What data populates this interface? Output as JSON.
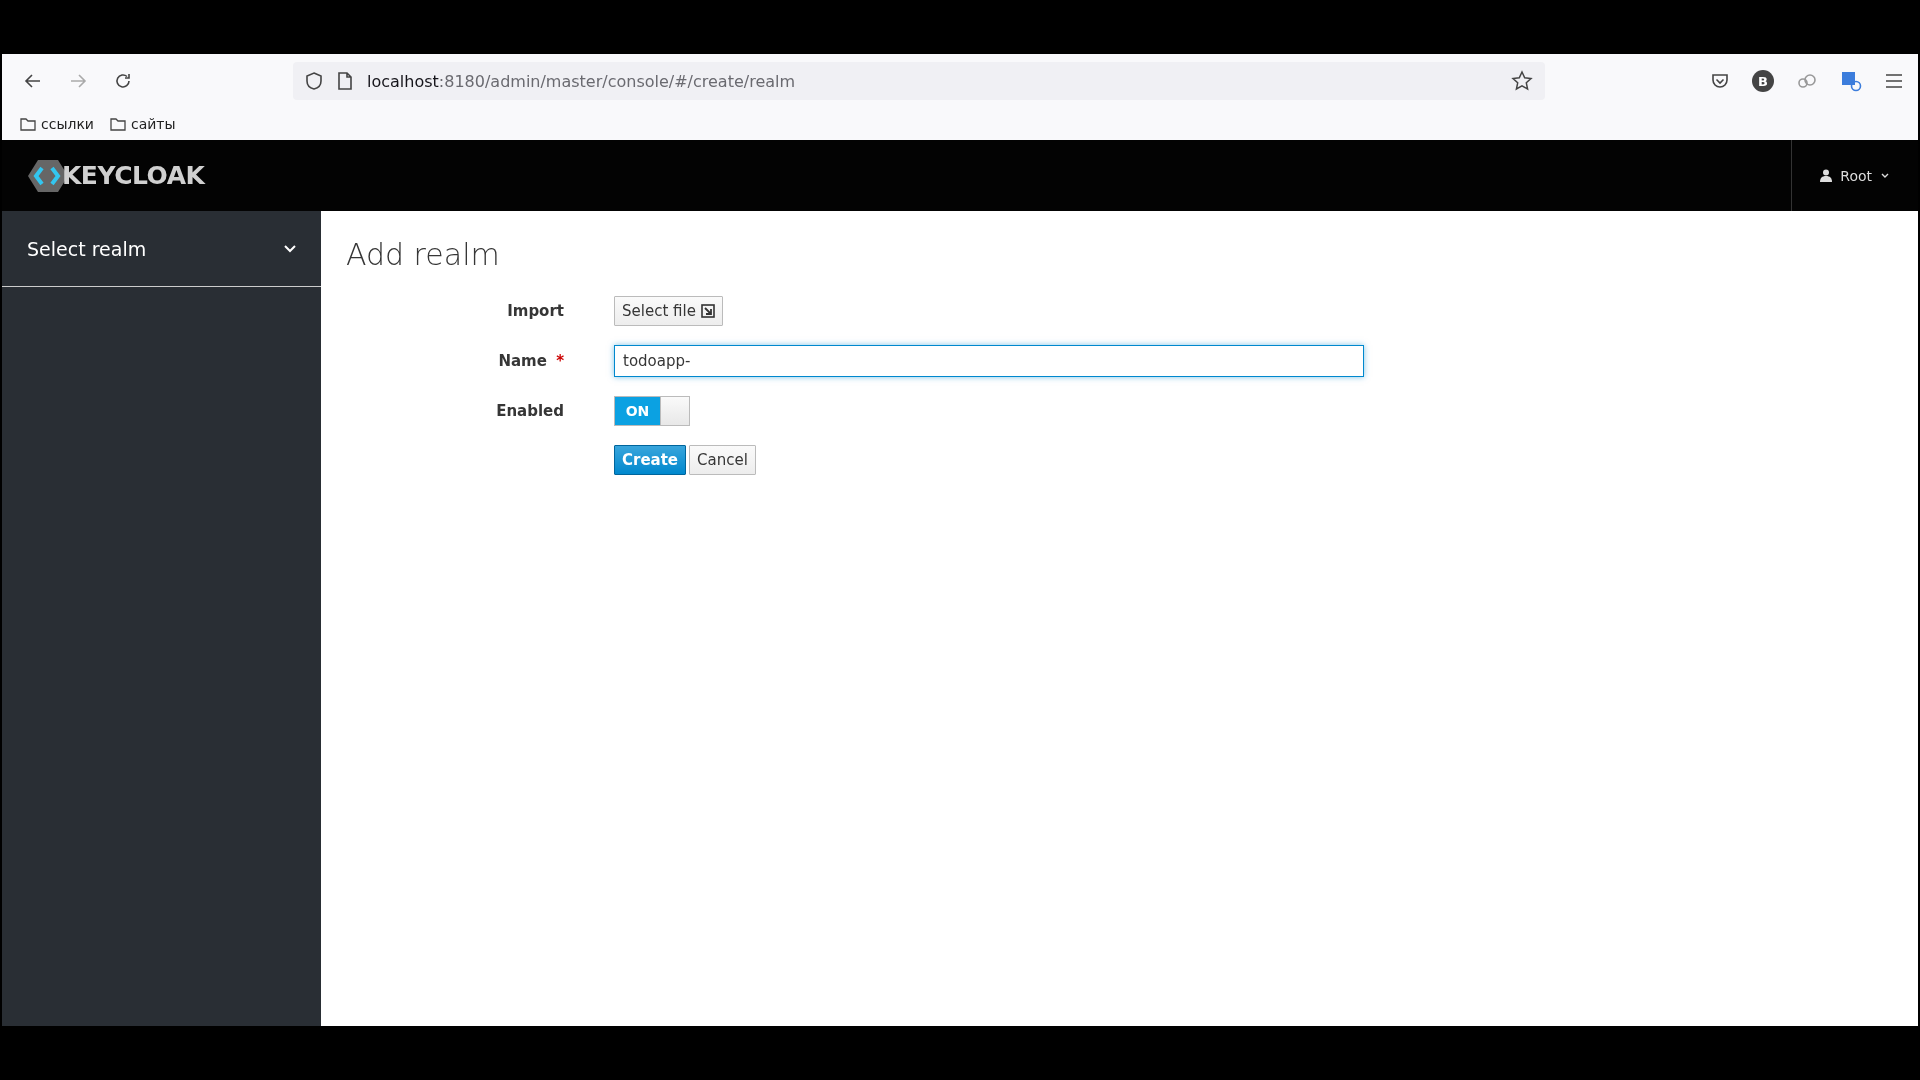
{
  "browser": {
    "url_host": "localhost",
    "url_path": ":8180/admin/master/console/#/create/realm",
    "profile_letter": "B",
    "bookmarks": [
      "ссылки",
      "сайты"
    ]
  },
  "header": {
    "logo_text": "KEYCLOAK",
    "user": "Root"
  },
  "sidebar": {
    "realm_select": "Select realm"
  },
  "page": {
    "title": "Add realm",
    "fields": [
      {
        "kind": "file",
        "label": "Import",
        "button": "Select file"
      },
      {
        "kind": "text",
        "label": "Name",
        "required_mark": "*",
        "value": "todoapp-",
        "focused": true
      },
      {
        "kind": "switch",
        "label": "Enabled",
        "on_label": "ON",
        "on": true
      }
    ],
    "buttons": [
      {
        "label": "Create",
        "primary": true
      },
      {
        "label": "Cancel",
        "primary": false
      }
    ]
  }
}
